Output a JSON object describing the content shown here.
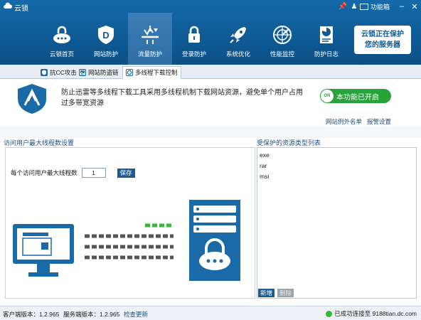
{
  "app": {
    "title": "云锁"
  },
  "titlebar": {
    "menu_label": "功能箱"
  },
  "nav": {
    "items": [
      {
        "label": "云锁首页",
        "icon": "home-lock-icon"
      },
      {
        "label": "网站防护",
        "icon": "shield-d-icon"
      },
      {
        "label": "流量防护",
        "icon": "traffic-icon",
        "active": true
      },
      {
        "label": "登录防护",
        "icon": "padlock-icon"
      },
      {
        "label": "系统优化",
        "icon": "rocket-icon"
      },
      {
        "label": "性能监控",
        "icon": "radar-icon"
      },
      {
        "label": "防护日志",
        "icon": "log-chart-icon"
      }
    ]
  },
  "promo": {
    "line1": "云锁正在保护",
    "line2": "您的服务器"
  },
  "subtabs": [
    {
      "label": "抗CC攻击"
    },
    {
      "label": "网站防盗链"
    },
    {
      "label": "多线程下载控制",
      "active": true
    }
  ],
  "banner": {
    "description": "防止迅雷等多线程下载工具采用多线程机制下载网站资源，避免单个用户占用过多带宽资源",
    "toggle_on": "ON",
    "toggle_label": "本功能已开启",
    "link_whitelist": "网站例外名单",
    "link_report": "报警设置"
  },
  "left_panel": {
    "title": "访问用户最大线程数设置",
    "thread_label": "每个访问用户最大线程数",
    "thread_value": "1",
    "save_button": "保存"
  },
  "right_panel": {
    "title": "受保护的资源类型列表",
    "items": [
      "exe",
      "rar",
      "msi"
    ],
    "add_button": "新增",
    "delete_button": "删除"
  },
  "status": {
    "client_version": "客户端版本：1.2.965",
    "server_version": "服务端版本：1.2.965",
    "check_update": "检查更新",
    "connection": "已成功连接至 9188tian.dc.com"
  },
  "colors": {
    "header_blue": "#0f5a96",
    "active_nav": "#3b7db6",
    "toggle_green": "#27a33a",
    "link_blue": "#1e4f7e"
  }
}
